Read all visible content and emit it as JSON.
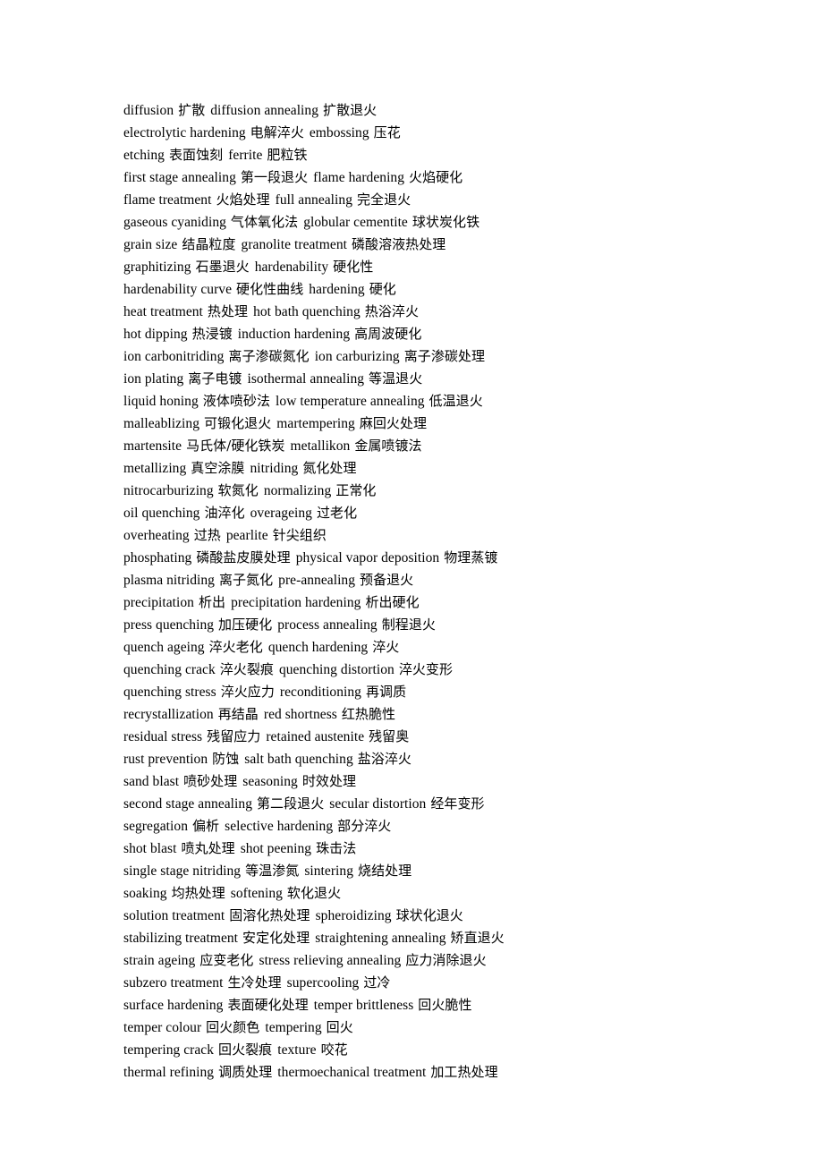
{
  "document": {
    "type": "bilingual-glossary",
    "subject": "heat treatment and metallurgy terminology",
    "language_pair": "English-Chinese",
    "page_background": "#ffffff",
    "text_color": "#000000",
    "line_count": 45
  },
  "lines": [
    {
      "pairs": [
        {
          "en": "diffusion",
          "zh": "扩散"
        },
        {
          "en": "diffusion annealing",
          "zh": "扩散退火"
        }
      ]
    },
    {
      "pairs": [
        {
          "en": "electrolytic hardening",
          "zh": "电解淬火"
        },
        {
          "en": "embossing",
          "zh": "压花"
        }
      ]
    },
    {
      "pairs": [
        {
          "en": "etching",
          "zh": "表面蚀刻"
        },
        {
          "en": "ferrite",
          "zh": "肥粒铁"
        }
      ]
    },
    {
      "pairs": [
        {
          "en": "first stage annealing",
          "zh": "第一段退火"
        },
        {
          "en": "flame hardening",
          "zh": "火焰硬化"
        }
      ]
    },
    {
      "pairs": [
        {
          "en": "flame treatment",
          "zh": "火焰处理"
        },
        {
          "en": "full annealing",
          "zh": "完全退火"
        }
      ]
    },
    {
      "pairs": [
        {
          "en": "gaseous cyaniding",
          "zh": "气体氧化法"
        },
        {
          "en": "globular cementite",
          "zh": "球状炭化铁"
        }
      ]
    },
    {
      "pairs": [
        {
          "en": "grain size",
          "zh": "结晶粒度"
        },
        {
          "en": "granolite treatment",
          "zh": "磷酸溶液热处理"
        }
      ]
    },
    {
      "pairs": [
        {
          "en": "graphitizing",
          "zh": "石墨退火"
        },
        {
          "en": "hardenability",
          "zh": "硬化性"
        }
      ]
    },
    {
      "pairs": [
        {
          "en": "hardenability curve",
          "zh": "硬化性曲线"
        },
        {
          "en": "hardening",
          "zh": "硬化"
        }
      ]
    },
    {
      "pairs": [
        {
          "en": "heat treatment",
          "zh": "热处理"
        },
        {
          "en": "hot bath quenching",
          "zh": "热浴淬火"
        }
      ]
    },
    {
      "pairs": [
        {
          "en": "hot dipping",
          "zh": "热浸镀"
        },
        {
          "en": "induction hardening",
          "zh": "高周波硬化"
        }
      ]
    },
    {
      "pairs": [
        {
          "en": "ion carbonitriding",
          "zh": "离子渗碳氮化"
        },
        {
          "en": "ion carburizing",
          "zh": "离子渗碳处理"
        }
      ]
    },
    {
      "pairs": [
        {
          "en": "ion plating",
          "zh": "离子电镀"
        },
        {
          "en": "isothermal annealing",
          "zh": "等温退火"
        }
      ]
    },
    {
      "pairs": [
        {
          "en": "liquid honing",
          "zh": "液体喷砂法"
        },
        {
          "en": "low temperature annealing",
          "zh": "低温退火"
        }
      ]
    },
    {
      "pairs": [
        {
          "en": "malleablizing",
          "zh": "可锻化退火"
        },
        {
          "en": "martempering",
          "zh": "麻回火处理"
        }
      ]
    },
    {
      "pairs": [
        {
          "en": "martensite",
          "zh": "马氏体/硬化铁炭"
        },
        {
          "en": "metallikon",
          "zh": "金属喷镀法"
        }
      ]
    },
    {
      "pairs": [
        {
          "en": "metallizing",
          "zh": "真空涂膜"
        },
        {
          "en": "nitriding",
          "zh": "氮化处理"
        }
      ]
    },
    {
      "pairs": [
        {
          "en": "nitrocarburizing",
          "zh": "软氮化"
        },
        {
          "en": "normalizing",
          "zh": "正常化"
        }
      ]
    },
    {
      "pairs": [
        {
          "en": "oil quenching",
          "zh": "油淬化"
        },
        {
          "en": "overageing",
          "zh": "过老化"
        }
      ]
    },
    {
      "pairs": [
        {
          "en": "overheating",
          "zh": "过热"
        },
        {
          "en": "pearlite",
          "zh": "针尖组织"
        }
      ]
    },
    {
      "pairs": [
        {
          "en": "phosphating",
          "zh": "磷酸盐皮膜处理"
        },
        {
          "en": "physical vapor deposition",
          "zh": "物理蒸镀"
        }
      ]
    },
    {
      "pairs": [
        {
          "en": "plasma nitriding",
          "zh": "离子氮化"
        },
        {
          "en": "pre-annealing",
          "zh": "预备退火"
        }
      ]
    },
    {
      "pairs": [
        {
          "en": "precipitation",
          "zh": "析出"
        },
        {
          "en": "precipitation hardening",
          "zh": "析出硬化"
        }
      ]
    },
    {
      "pairs": [
        {
          "en": "press quenching",
          "zh": "加压硬化"
        },
        {
          "en": "process annealing",
          "zh": "制程退火"
        }
      ]
    },
    {
      "pairs": [
        {
          "en": "quench ageing",
          "zh": "淬火老化"
        },
        {
          "en": "quench hardening",
          "zh": "淬火"
        }
      ]
    },
    {
      "pairs": [
        {
          "en": "quenching crack",
          "zh": "淬火裂痕"
        },
        {
          "en": "quenching distortion",
          "zh": "淬火变形"
        }
      ]
    },
    {
      "pairs": [
        {
          "en": "quenching stress",
          "zh": "淬火应力"
        },
        {
          "en": "reconditioning",
          "zh": "再调质"
        }
      ]
    },
    {
      "pairs": [
        {
          "en": "recrystallization",
          "zh": "再结晶"
        },
        {
          "en": "red shortness",
          "zh": "红热脆性"
        }
      ]
    },
    {
      "pairs": [
        {
          "en": "residual stress",
          "zh": "残留应力"
        },
        {
          "en": "retained austenite",
          "zh": "残留奥"
        }
      ]
    },
    {
      "pairs": [
        {
          "en": "rust prevention",
          "zh": "防蚀"
        },
        {
          "en": "salt bath quenching",
          "zh": "盐浴淬火"
        }
      ]
    },
    {
      "pairs": [
        {
          "en": "sand blast",
          "zh": "喷砂处理"
        },
        {
          "en": "seasoning",
          "zh": "时效处理"
        }
      ]
    },
    {
      "pairs": [
        {
          "en": "second stage annealing",
          "zh": "第二段退火"
        },
        {
          "en": "secular distortion",
          "zh": "经年变形"
        }
      ]
    },
    {
      "pairs": [
        {
          "en": "segregation",
          "zh": "偏析"
        },
        {
          "en": "selective hardening",
          "zh": "部分淬火"
        }
      ]
    },
    {
      "pairs": [
        {
          "en": "shot blast",
          "zh": "喷丸处理"
        },
        {
          "en": "shot peening",
          "zh": "珠击法"
        }
      ]
    },
    {
      "pairs": [
        {
          "en": "single stage nitriding",
          "zh": "等温渗氮"
        },
        {
          "en": "sintering",
          "zh": "烧结处理"
        }
      ]
    },
    {
      "pairs": [
        {
          "en": "soaking",
          "zh": "均热处理"
        },
        {
          "en": "softening",
          "zh": "软化退火"
        }
      ]
    },
    {
      "pairs": [
        {
          "en": "solution treatment",
          "zh": "固溶化热处理"
        },
        {
          "en": "spheroidizing",
          "zh": "球状化退火"
        }
      ]
    },
    {
      "pairs": [
        {
          "en": "stabilizing treatment",
          "zh": "安定化处理"
        },
        {
          "en": "straightening annealing",
          "zh": "矫直退火"
        }
      ]
    },
    {
      "pairs": [
        {
          "en": "strain ageing",
          "zh": "应变老化"
        },
        {
          "en": "stress relieving annealing",
          "zh": "应力消除退火"
        }
      ]
    },
    {
      "pairs": [
        {
          "en": "subzero treatment",
          "zh": "生冷处理"
        },
        {
          "en": "supercooling",
          "zh": "过冷"
        }
      ]
    },
    {
      "pairs": [
        {
          "en": "surface hardening",
          "zh": "表面硬化处理"
        },
        {
          "en": "temper brittleness",
          "zh": "回火脆性"
        }
      ]
    },
    {
      "pairs": [
        {
          "en": "temper colour",
          "zh": "回火颜色"
        },
        {
          "en": "tempering",
          "zh": "回火"
        }
      ]
    },
    {
      "pairs": [
        {
          "en": "tempering crack",
          "zh": "回火裂痕"
        },
        {
          "en": "texture",
          "zh": "咬花"
        }
      ]
    },
    {
      "pairs": [
        {
          "en": "thermal refining",
          "zh": "调质处理"
        },
        {
          "en": "thermoechanical treatment",
          "zh": "加工热处理"
        }
      ]
    }
  ]
}
